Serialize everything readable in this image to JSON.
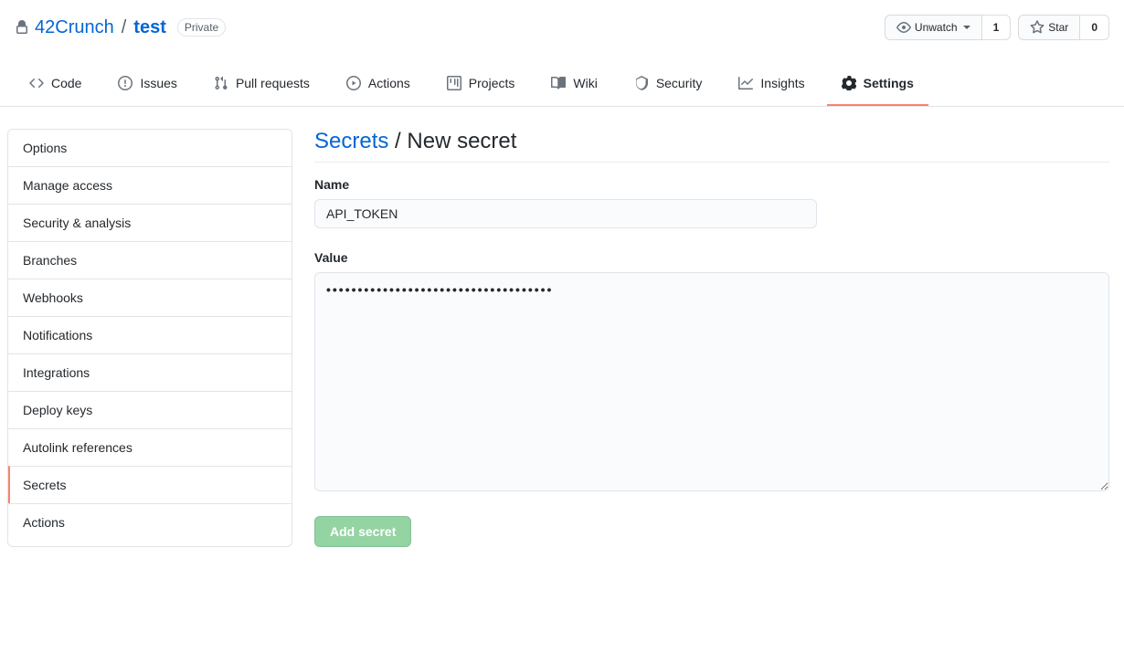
{
  "repo": {
    "owner": "42Crunch",
    "name": "test",
    "visibility": "Private"
  },
  "actions": {
    "unwatch_label": "Unwatch",
    "watch_count": "1",
    "star_label": "Star",
    "star_count": "0"
  },
  "tabs": [
    {
      "label": "Code",
      "icon": "code"
    },
    {
      "label": "Issues",
      "icon": "issue"
    },
    {
      "label": "Pull requests",
      "icon": "pr"
    },
    {
      "label": "Actions",
      "icon": "play"
    },
    {
      "label": "Projects",
      "icon": "project"
    },
    {
      "label": "Wiki",
      "icon": "book"
    },
    {
      "label": "Security",
      "icon": "shield"
    },
    {
      "label": "Insights",
      "icon": "graph"
    },
    {
      "label": "Settings",
      "icon": "gear",
      "selected": true
    }
  ],
  "sidenav": {
    "items": [
      {
        "label": "Options"
      },
      {
        "label": "Manage access"
      },
      {
        "label": "Security & analysis"
      },
      {
        "label": "Branches"
      },
      {
        "label": "Webhooks"
      },
      {
        "label": "Notifications"
      },
      {
        "label": "Integrations"
      },
      {
        "label": "Deploy keys"
      },
      {
        "label": "Autolink references"
      },
      {
        "label": "Secrets",
        "selected": true
      },
      {
        "label": "Actions"
      }
    ]
  },
  "page": {
    "breadcrumb_parent": "Secrets",
    "breadcrumb_current": "New secret",
    "name_label": "Name",
    "name_value": "API_TOKEN",
    "value_label": "Value",
    "value_value": "••••••••••••••••••••••••••••••••••••",
    "submit_label": "Add secret"
  }
}
